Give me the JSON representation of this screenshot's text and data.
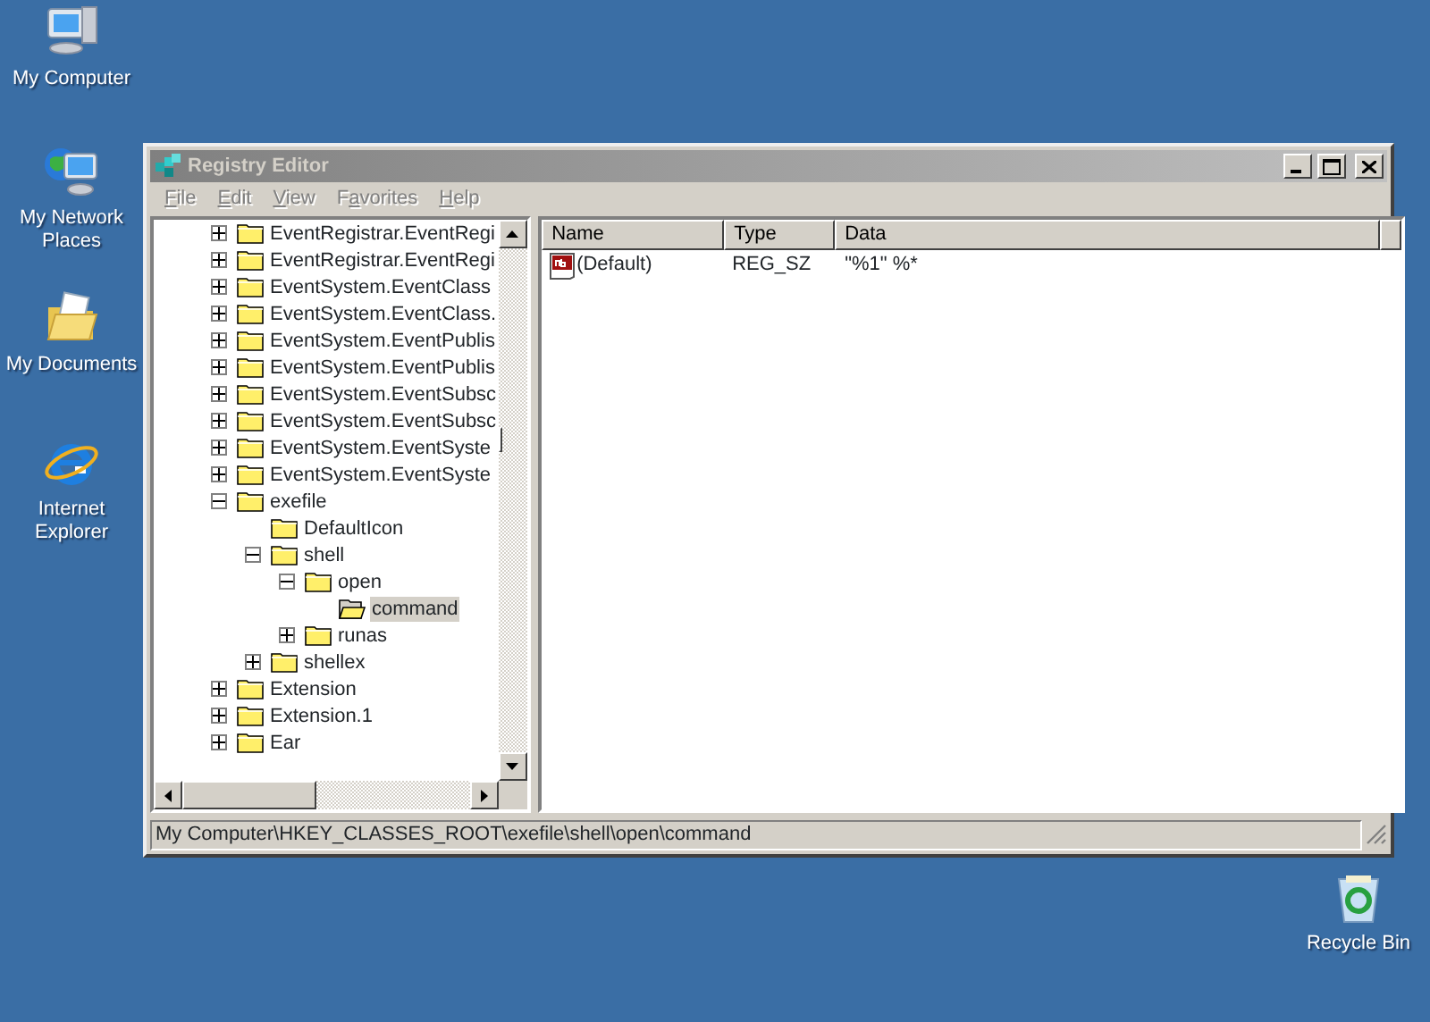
{
  "desktop_icons": [
    {
      "label": "My Computer",
      "kind": "computer"
    },
    {
      "label": "My Network Places",
      "kind": "network"
    },
    {
      "label": "My Documents",
      "kind": "documents"
    },
    {
      "label": "Internet Explorer",
      "kind": "browser"
    },
    {
      "label": "Recycle Bin",
      "kind": "recycle"
    }
  ],
  "window": {
    "title": "Registry Editor",
    "active": false
  },
  "menu": [
    {
      "access_key": "F",
      "rest": "ile"
    },
    {
      "access_key": "E",
      "rest": "dit"
    },
    {
      "access_key": "V",
      "rest": "iew"
    },
    {
      "before": "F",
      "access_key": "a",
      "rest": "vorites"
    },
    {
      "access_key": "H",
      "rest": "elp"
    }
  ],
  "tree": {
    "items": [
      {
        "label": "EventRegistrar.EventRegi",
        "has_children": true,
        "expanded": false,
        "selected": false
      },
      {
        "label": "EventRegistrar.EventRegi",
        "has_children": true,
        "expanded": false,
        "selected": false
      },
      {
        "label": "EventSystem.EventClass",
        "has_children": true,
        "expanded": false,
        "selected": false
      },
      {
        "label": "EventSystem.EventClass.",
        "has_children": true,
        "expanded": false,
        "selected": false
      },
      {
        "label": "EventSystem.EventPublis",
        "has_children": true,
        "expanded": false,
        "selected": false
      },
      {
        "label": "EventSystem.EventPublis",
        "has_children": true,
        "expanded": false,
        "selected": false
      },
      {
        "label": "EventSystem.EventSubsc",
        "has_children": true,
        "expanded": false,
        "selected": false
      },
      {
        "label": "EventSystem.EventSubsc",
        "has_children": true,
        "expanded": false,
        "selected": false
      },
      {
        "label": "EventSystem.EventSyste",
        "has_children": true,
        "expanded": false,
        "selected": false
      },
      {
        "label": "EventSystem.EventSyste",
        "has_children": true,
        "expanded": false,
        "selected": false
      },
      {
        "label": "exefile",
        "has_children": true,
        "expanded": true,
        "selected": false,
        "children": [
          {
            "label": "DefaultIcon",
            "has_children": false,
            "selected": false
          },
          {
            "label": "shell",
            "has_children": true,
            "expanded": true,
            "selected": false,
            "children": [
              {
                "label": "open",
                "has_children": true,
                "expanded": true,
                "selected": false,
                "children": [
                  {
                    "label": "command",
                    "has_children": false,
                    "selected": true
                  }
                ]
              },
              {
                "label": "runas",
                "has_children": true,
                "expanded": false,
                "selected": false
              }
            ]
          },
          {
            "label": "shellex",
            "has_children": true,
            "expanded": false,
            "selected": false
          }
        ]
      },
      {
        "label": "Extension",
        "has_children": true,
        "expanded": false,
        "selected": false
      },
      {
        "label": "Extension.1",
        "has_children": true,
        "expanded": false,
        "selected": false
      },
      {
        "label": "Ear",
        "has_children": true,
        "expanded": false,
        "selected": false
      }
    ]
  },
  "values": {
    "columns": [
      "Name",
      "Type",
      "Data"
    ],
    "rows": [
      {
        "name": "(Default)",
        "type": "REG_SZ",
        "data": "\"%1\" %*"
      }
    ]
  },
  "status_bar": "My Computer\\HKEY_CLASSES_ROOT\\exefile\\shell\\open\\command"
}
